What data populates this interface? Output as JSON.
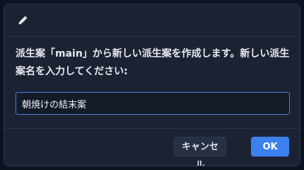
{
  "dialog": {
    "icon": "pencil-icon",
    "message": "派生案「main」から新しい派生案を作成します。新しい派生案名を入力してください:",
    "input": {
      "value": "朝焼けの結末案",
      "placeholder": ""
    },
    "buttons": {
      "cancel_label": "キャンセル",
      "ok_label": "OK"
    }
  },
  "colors": {
    "background": "#0d1421",
    "dialog_bg": "#1b2333",
    "accent": "#3b82f0",
    "input_border": "#4a7fd4"
  }
}
